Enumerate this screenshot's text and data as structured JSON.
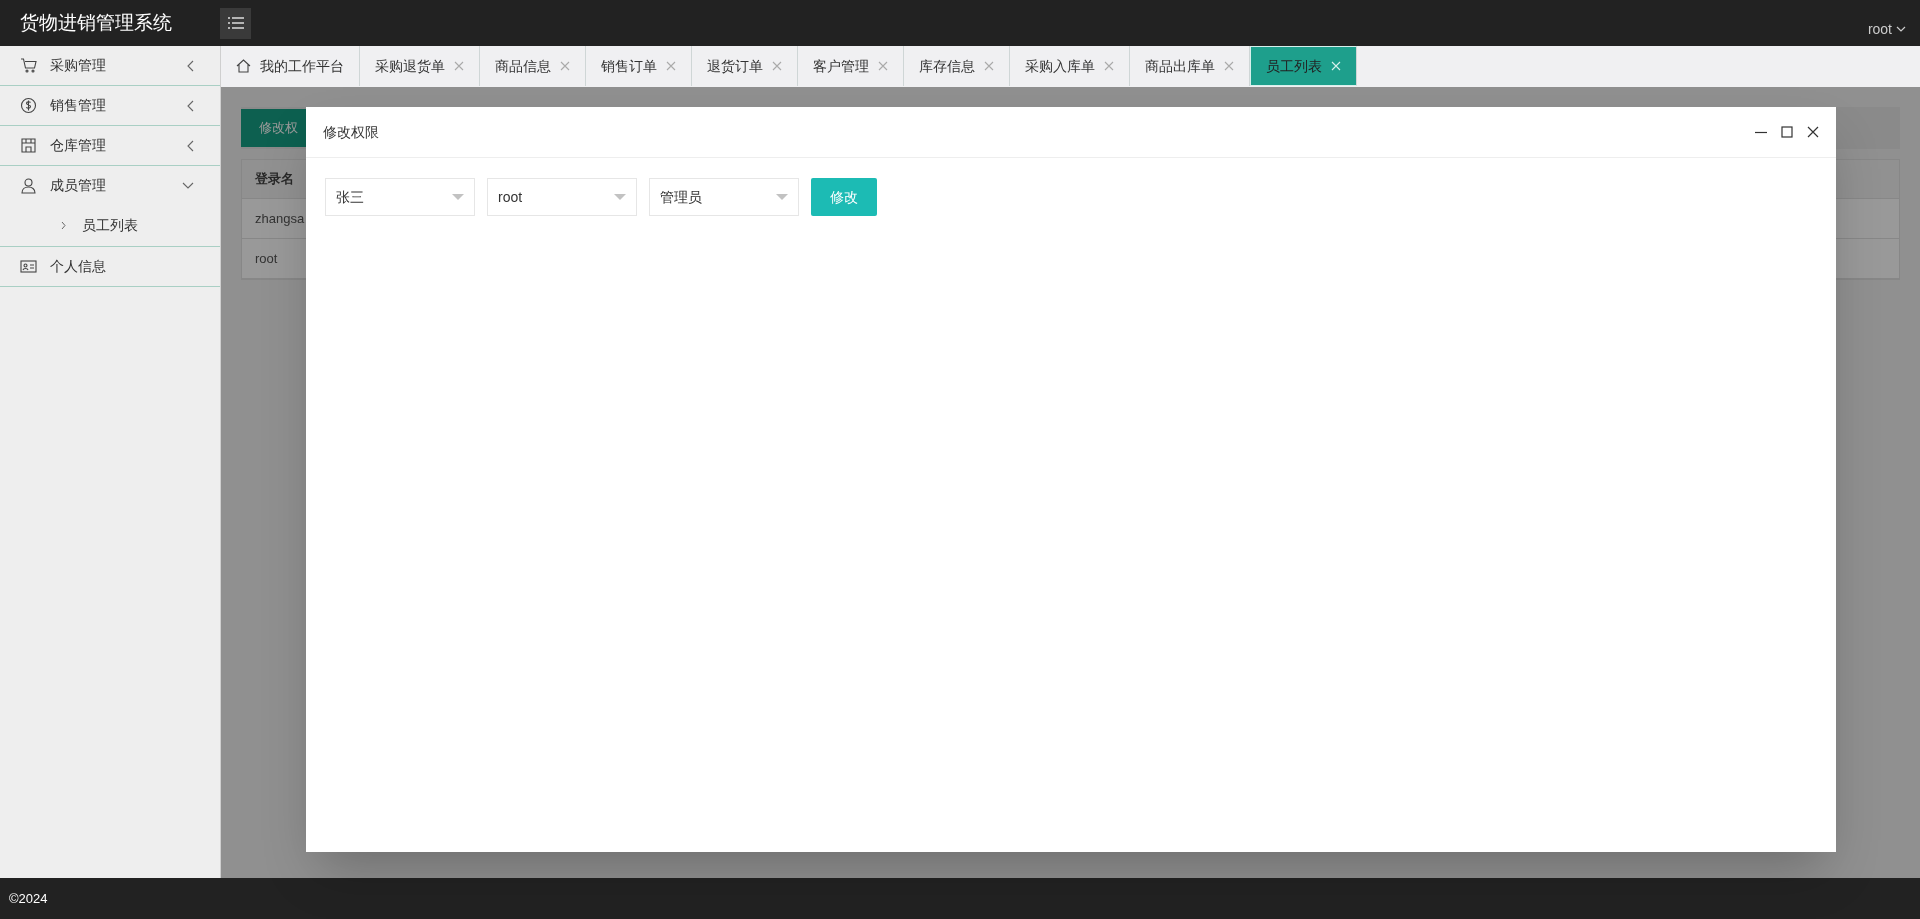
{
  "header": {
    "title": "货物进销管理系统",
    "user": "root"
  },
  "sidebar": {
    "items": [
      {
        "label": "采购管理",
        "kind": "group",
        "expanded": false
      },
      {
        "label": "销售管理",
        "kind": "group",
        "expanded": false
      },
      {
        "label": "仓库管理",
        "kind": "group",
        "expanded": false
      },
      {
        "label": "成员管理",
        "kind": "group",
        "expanded": true,
        "children": [
          {
            "label": "员工列表"
          }
        ]
      },
      {
        "label": "个人信息",
        "kind": "link"
      }
    ]
  },
  "tabs": [
    {
      "label": "我的工作平台",
      "kind": "home",
      "selected": false
    },
    {
      "label": "采购退货单",
      "kind": "closable",
      "selected": false
    },
    {
      "label": "商品信息",
      "kind": "closable",
      "selected": false
    },
    {
      "label": "销售订单",
      "kind": "closable",
      "selected": false
    },
    {
      "label": "退货订单",
      "kind": "closable",
      "selected": false
    },
    {
      "label": "客户管理",
      "kind": "closable",
      "selected": false
    },
    {
      "label": "库存信息",
      "kind": "closable",
      "selected": false
    },
    {
      "label": "采购入库单",
      "kind": "closable",
      "selected": false
    },
    {
      "label": "商品出库单",
      "kind": "closable",
      "selected": false
    },
    {
      "label": "员工列表",
      "kind": "closable",
      "selected": true
    }
  ],
  "content": {
    "button": "修改权",
    "table": {
      "columns": [
        "登录名"
      ],
      "rows": [
        [
          "zhangsa"
        ],
        [
          "root"
        ]
      ]
    }
  },
  "dialog": {
    "title": "修改权限",
    "selects": [
      "张三",
      "root",
      "管理员"
    ],
    "button": "修改"
  },
  "footer": {
    "copyright": "©2024"
  }
}
